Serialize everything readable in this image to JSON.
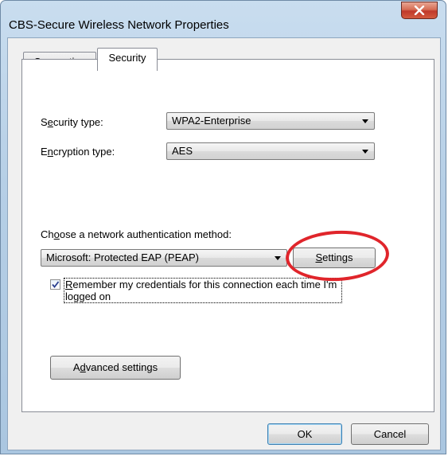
{
  "window": {
    "title": "CBS-Secure Wireless Network Properties"
  },
  "tabs": [
    {
      "label": "Connection",
      "active": false
    },
    {
      "label": "Security",
      "active": true
    }
  ],
  "security": {
    "security_type_label_pre": "S",
    "security_type_label_ul": "e",
    "security_type_label_post": "curity type:",
    "security_type_value": "WPA2-Enterprise",
    "encryption_type_label_pre": "E",
    "encryption_type_label_ul": "n",
    "encryption_type_label_post": "cryption type:",
    "encryption_type_value": "AES",
    "auth_method_label_pre": "Ch",
    "auth_method_label_ul": "o",
    "auth_method_label_post": "ose a network authentication method:",
    "auth_method_value": "Microsoft: Protected EAP (PEAP)",
    "settings_button_ul": "S",
    "settings_button_post": "ettings",
    "remember_checked": true,
    "remember_label_ul": "R",
    "remember_label_post": "emember my credentials for this connection each time I'm logged on",
    "advanced_button_pre": "A",
    "advanced_button_ul": "d",
    "advanced_button_post": "vanced settings"
  },
  "footer": {
    "ok_label": "OK",
    "cancel_label": "Cancel"
  },
  "colors": {
    "highlight_ellipse": "#e0252b",
    "close_button": "#c0392b"
  },
  "icons": {
    "close": "close-icon",
    "checkmark": "checkmark-icon",
    "dropdown": "chevron-down-icon"
  }
}
